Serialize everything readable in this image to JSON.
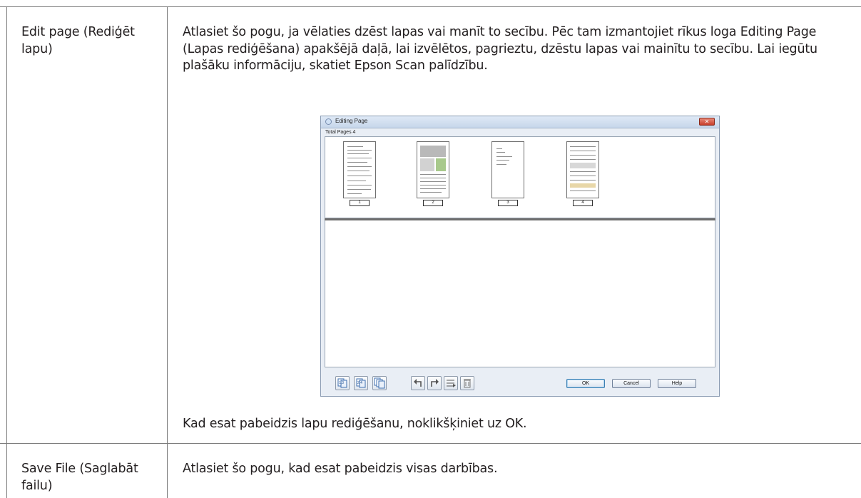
{
  "rows": [
    {
      "term": "Edit page (Rediģēt lapu)",
      "description": "Atlasiet šo pogu, ja vēlaties dzēst lapas vai manīt to secību. Pēc tam izmantojiet rīkus loga Editing Page (Lapas rediģēšana) apakšējā daļā, lai izvēlētos, pagrieztu, dzēstu lapas vai mainītu to secību. Lai iegūtu plašāku informāciju, skatiet Epson Scan palīdzību.",
      "after_image": "Kad esat pabeidzis lapu rediģēšanu, noklikšķiniet uz OK."
    },
    {
      "term": "Save File (Saglabāt failu)",
      "description": "Atlasiet šo pogu, kad esat pabeidzis visas darbības."
    }
  ],
  "dialog": {
    "title": "Editing Page",
    "total_pages": "Total Pages 4",
    "pages": [
      "1",
      "2",
      "3",
      "4"
    ],
    "toolbar_icons": [
      "select-odd-pages-icon",
      "select-even-pages-icon",
      "select-all-pages-icon",
      "rotate-left-icon",
      "rotate-right-icon",
      "move-page-icon",
      "delete-page-icon"
    ],
    "buttons": {
      "ok": "OK",
      "cancel": "Cancel",
      "help": "Help"
    },
    "close_glyph": "✕"
  }
}
